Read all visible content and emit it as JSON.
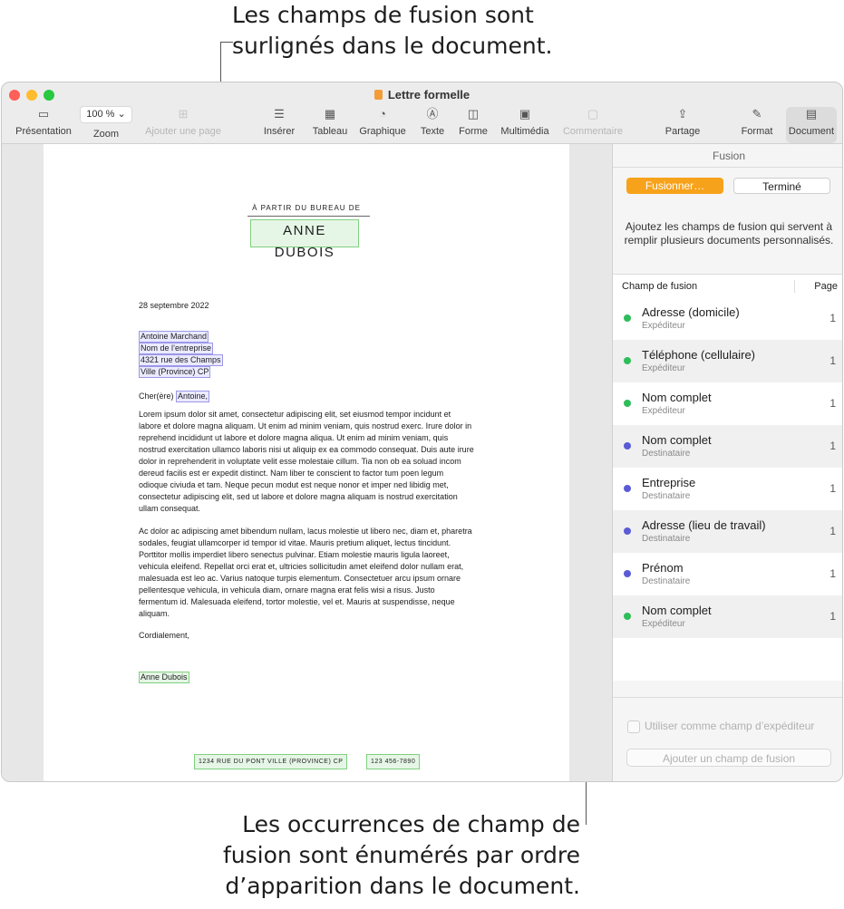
{
  "callouts": {
    "top_line1": "Les champs de fusion sont",
    "top_line2": "surlignés dans le document.",
    "bottom_line1": "Les occurrences de champ de",
    "bottom_line2": "fusion sont énumérés par ordre",
    "bottom_line3": "d’apparition dans le document."
  },
  "window": {
    "title": "Lettre formelle"
  },
  "toolbar": {
    "presentation": "Présentation",
    "zoom_value": "100 % ⌄",
    "zoom": "Zoom",
    "add_page": "Ajouter une page",
    "insert": "Insérer",
    "table": "Tableau",
    "chart": "Graphique",
    "text": "Texte",
    "shape": "Forme",
    "media": "Multimédia",
    "comment": "Commentaire",
    "share": "Partage",
    "format": "Format",
    "document": "Document"
  },
  "letter": {
    "from_label": "À PARTIR DU BUREAU DE",
    "sender_name": "ANNE DUBOIS",
    "date": "28 septembre 2022",
    "recipient_name": "Antoine Marchand",
    "company": "Nom de l’entreprise",
    "street": "4321 rue des Champs",
    "city": "Ville (Province)  CP",
    "salutation_prefix": "Cher(ère) ",
    "salutation_name": "Antoine,",
    "para1": "Lorem ipsum dolor sit amet, consectetur adipiscing elit, set eiusmod tempor incidunt et labore et dolore magna aliquam. Ut enim ad minim veniam, quis nostrud exerc. Irure dolor in reprehend incididunt ut labore et dolore magna aliqua. Ut enim ad minim veniam, quis nostrud exercitation ullamco laboris nisi ut aliquip ex ea commodo consequat. Duis aute irure dolor in reprehenderit in voluptate velit esse molestaie cillum. Tia non ob ea soluad incom dereud facilis est er expedit distinct. Nam liber te conscient to factor tum poen legum odioque civiuda et tam. Neque pecun modut est neque nonor et imper ned libidig met, consectetur adipiscing elit, sed ut labore et dolore magna aliquam is nostrud exercitation ullam consequat.",
    "para2": "Ac dolor ac adipiscing amet bibendum nullam, lacus molestie ut libero nec, diam et, pharetra sodales, feugiat ullamcorper id tempor id vitae. Mauris pretium aliquet, lectus tincidunt. Porttitor mollis imperdiet libero senectus pulvinar. Etiam molestie mauris ligula laoreet, vehicula eleifend. Repellat orci erat et, ultricies sollicitudin amet eleifend dolor nullam erat, malesuada est leo ac. Varius natoque turpis elementum. Consectetuer arcu ipsum ornare pellentesque vehicula, in vehicula diam, ornare magna erat felis wisi a risus. Justo fermentum id. Malesuada eleifend, tortor molestie, vel et. Mauris at suspendisse, neque aliquam.",
    "closing": "Cordialement,",
    "signature": "Anne Dubois",
    "footer_address": "1234 RUE DU PONT   VILLE (PROVINCE)  CP",
    "footer_phone": "123 456-7890"
  },
  "sidebar": {
    "title": "Fusion",
    "merge_button": "Fusionner…",
    "done_button": "Terminé",
    "description": "Ajoutez les champs de fusion qui servent à remplir plusieurs documents personnalisés.",
    "col_field": "Champ de fusion",
    "col_page": "Page",
    "fields": [
      {
        "name": "Adresse (domicile)",
        "role": "Expéditeur",
        "page": "1"
      },
      {
        "name": "Téléphone (cellulaire)",
        "role": "Expéditeur",
        "page": "1"
      },
      {
        "name": "Nom complet",
        "role": "Expéditeur",
        "page": "1"
      },
      {
        "name": "Nom complet",
        "role": "Destinataire",
        "page": "1"
      },
      {
        "name": "Entreprise",
        "role": "Destinataire",
        "page": "1"
      },
      {
        "name": "Adresse (lieu de travail)",
        "role": "Destinataire",
        "page": "1"
      },
      {
        "name": "Prénom",
        "role": "Destinataire",
        "page": "1"
      },
      {
        "name": "Nom complet",
        "role": "Expéditeur",
        "page": "1"
      }
    ],
    "use_as_sender": "Utiliser comme champ d’expéditeur",
    "add_field": "Ajouter un champ de fusion"
  },
  "colors": {
    "sender_dot": "#2ebd59",
    "recipient_dot": "#5b5bd6",
    "accent": "#f7a21b"
  }
}
